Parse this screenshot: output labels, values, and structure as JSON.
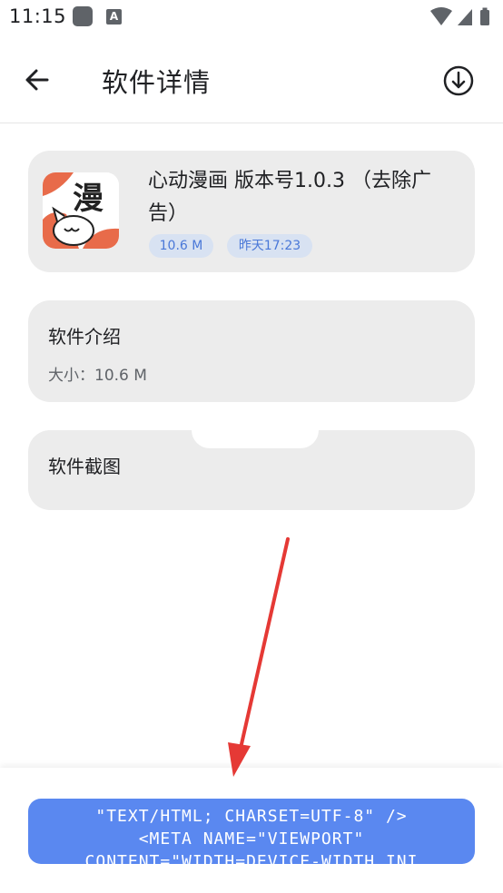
{
  "status": {
    "time": "11:15",
    "a_badge": "A"
  },
  "header": {
    "title": "软件详情"
  },
  "app": {
    "name": "心动漫画 版本号1.0.3 （去除广告）",
    "icon_char": "漫",
    "size_chip": "10.6 M",
    "time_chip": "昨天17:23"
  },
  "intro": {
    "heading": "软件介绍",
    "size_label": "大小：10.6 M"
  },
  "screenshots": {
    "heading": "软件截图"
  },
  "bottom_button": {
    "line1": "\"TEXT/HTML; CHARSET=UTF-8\" />",
    "line2": "<META NAME=\"VIEWPORT\"",
    "line3": "CONTENT=\"WIDTH=DEVICE-WIDTH,INI"
  },
  "colors": {
    "accent": "#5a88f0",
    "chip_bg": "#d8e2f2",
    "chip_text": "#4a78d8",
    "arrow": "#e53935",
    "card_bg": "#ececec"
  }
}
